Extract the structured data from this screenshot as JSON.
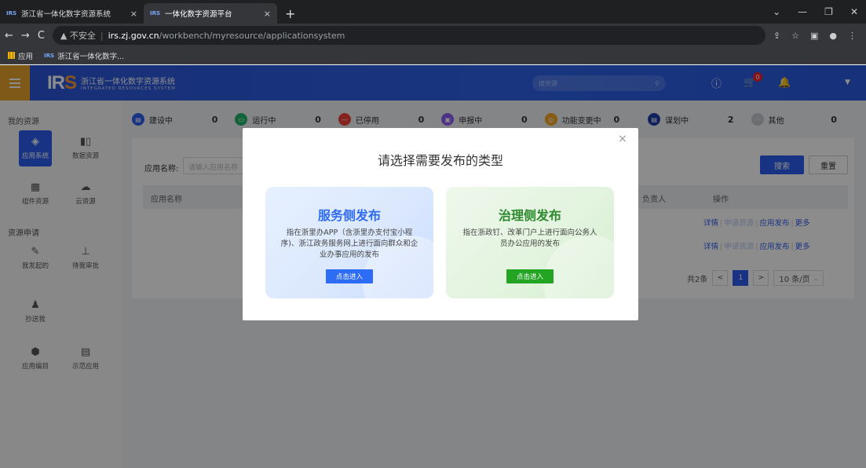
{
  "browser": {
    "tabs": [
      {
        "favicon": "IRS",
        "title": "浙江省一体化数字资源系统",
        "close": "×"
      },
      {
        "favicon": "IRS",
        "title": "一体化数字资源平台",
        "close": "×"
      }
    ],
    "new_tab": "+",
    "window_controls": [
      "⌄",
      "—",
      "❐",
      "✕"
    ],
    "address": {
      "security": "▲ 不安全",
      "domain": "irs.zj.gov.cn",
      "path": "/workbench/myresource/applicationsystem"
    },
    "bookmarks": [
      {
        "icon": "apps-grid-icon",
        "label": "应用"
      },
      {
        "icon": "IRS",
        "label": "浙江省一体化数字..."
      }
    ]
  },
  "header": {
    "logo_mark": "IR",
    "logo_mark_s": "S",
    "logo_cn": "浙江省一体化数字资源系统",
    "logo_en": "INTEGRATED RESOURCES SYSTEM",
    "search_placeholder": "搜资源",
    "cart_badge": "0"
  },
  "sidebar": {
    "section1": "我的资源",
    "section2": "资源申请",
    "items": [
      {
        "label": "应用系统",
        "icon": "cube-icon"
      },
      {
        "label": "数据资源",
        "icon": "data-bars-icon"
      },
      {
        "label": "组件资源",
        "icon": "component-icon"
      },
      {
        "label": "云资源",
        "icon": "cloud-icon"
      },
      {
        "label": "我发起的",
        "icon": "edit-icon"
      },
      {
        "label": "待我审批",
        "icon": "approve-icon"
      },
      {
        "label": "抄送我",
        "icon": "cc-user-icon"
      },
      {
        "label": "应用编目",
        "icon": "catalog-icon"
      },
      {
        "label": "示范应用",
        "icon": "demo-app-icon"
      }
    ]
  },
  "statuses": [
    {
      "label": "建设中",
      "count": "0",
      "color": "#2d5ef0"
    },
    {
      "label": "运行中",
      "count": "0",
      "color": "#21b36e"
    },
    {
      "label": "已停用",
      "count": "0",
      "color": "#f0413a"
    },
    {
      "label": "申报中",
      "count": "0",
      "color": "#8e5bf5"
    },
    {
      "label": "功能变更中",
      "count": "0",
      "color": "#f5a623"
    },
    {
      "label": "谋划中",
      "count": "2",
      "color": "#1f3da8"
    },
    {
      "label": "其他",
      "count": "0",
      "color": "#c7c9cf"
    }
  ],
  "filter": {
    "label": "应用名称:",
    "placeholder": "请输入应用名称",
    "search": "搜索",
    "reset": "重置"
  },
  "table": {
    "col_name": "应用名称",
    "col_owner": "负责人",
    "col_action": "操作",
    "rows": [
      {
        "detail": "详情",
        "apply": "申请资源",
        "publish": "应用发布",
        "more": "更多"
      },
      {
        "detail": "详情",
        "apply": "申请资源",
        "publish": "应用发布",
        "more": "更多"
      }
    ]
  },
  "pagination": {
    "total": "共2条",
    "prev": "<",
    "current": "1",
    "next": ">",
    "page_size": "10 条/页"
  },
  "modal": {
    "title": "请选择需要发布的类型",
    "close": "×",
    "cards": [
      {
        "title": "服务侧发布",
        "desc": "指在浙里办APP（含浙里办支付宝小程序)、浙江政务服务网上进行面向群众和企业办事应用的发布",
        "button": "点击进入"
      },
      {
        "title": "治理侧发布",
        "desc": "指在浙政钉、改革门户上进行面向公务人员办公应用的发布",
        "button": "点击进入"
      }
    ]
  }
}
